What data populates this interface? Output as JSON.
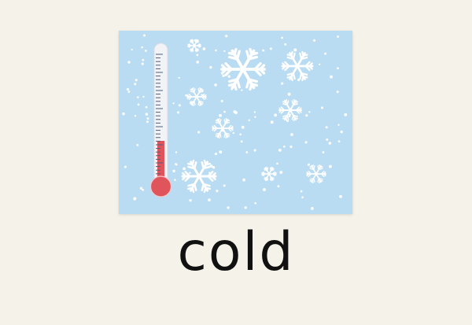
{
  "word": "cold",
  "illustration": {
    "icon": "thermometer-icon",
    "decoration": "snowflake-icon",
    "thermometer_level": 0.3
  },
  "colors": {
    "background": "#f4f2e9",
    "panel": "#b9dcf3",
    "snow": "#ffffff",
    "mercury": "#e0555c",
    "text": "#111111",
    "tube": "#f2f3f6",
    "ticks": "#4f5f78"
  }
}
